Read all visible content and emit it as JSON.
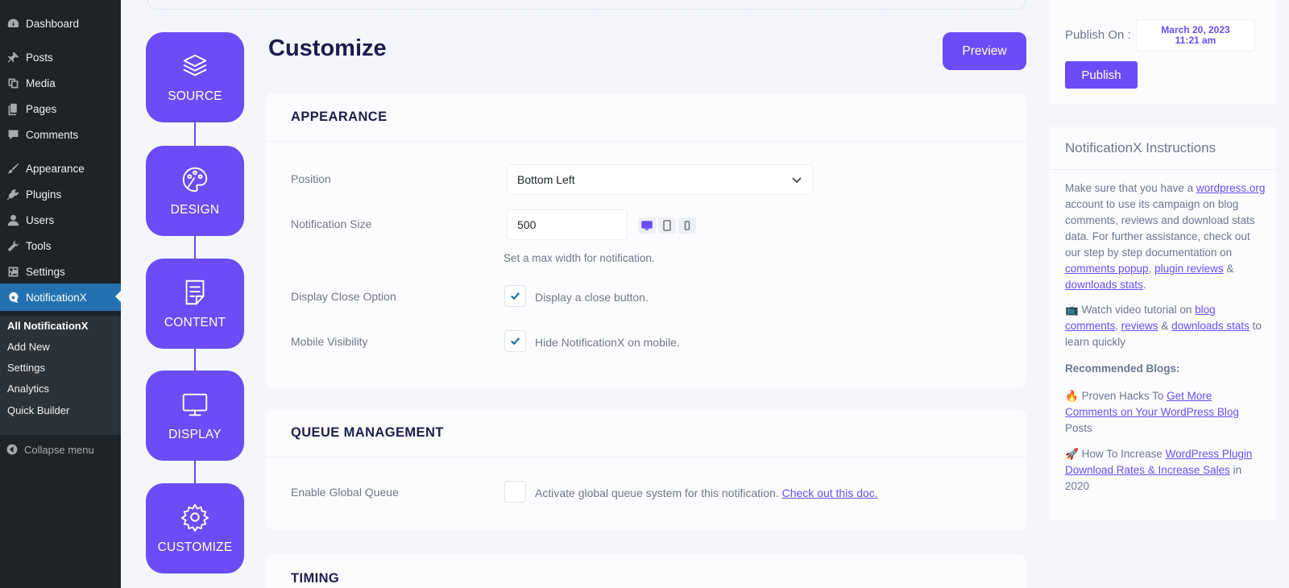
{
  "sidebar": {
    "items": [
      {
        "label": "Dashboard",
        "icon": "dashboard-icon"
      },
      {
        "label": "Posts",
        "icon": "pushpin-icon"
      },
      {
        "label": "Media",
        "icon": "media-icon"
      },
      {
        "label": "Pages",
        "icon": "pages-icon"
      },
      {
        "label": "Comments",
        "icon": "comment-icon"
      },
      {
        "label": "Appearance",
        "icon": "paintbrush-icon"
      },
      {
        "label": "Plugins",
        "icon": "plugin-icon"
      },
      {
        "label": "Users",
        "icon": "user-icon"
      },
      {
        "label": "Tools",
        "icon": "wrench-icon"
      },
      {
        "label": "Settings",
        "icon": "settings-icon"
      },
      {
        "label": "NotificationX",
        "icon": "notificationx-icon"
      }
    ],
    "submenu": [
      "All NotificationX",
      "Add New",
      "Settings",
      "Analytics",
      "Quick Builder"
    ],
    "collapse_label": "Collapse menu"
  },
  "steps": [
    {
      "label": "SOURCE",
      "icon": "layers-icon"
    },
    {
      "label": "DESIGN",
      "icon": "palette-icon"
    },
    {
      "label": "CONTENT",
      "icon": "document-icon"
    },
    {
      "label": "DISPLAY",
      "icon": "monitor-icon"
    },
    {
      "label": "CUSTOMIZE",
      "icon": "gear-icon"
    }
  ],
  "main": {
    "title": "Customize",
    "preview_label": "Preview",
    "appearance": {
      "heading": "APPEARANCE",
      "position_label": "Position",
      "position_value": "Bottom Left",
      "size_label": "Notification Size",
      "size_value": "500",
      "size_help": "Set a max width for notification.",
      "close_label": "Display Close Option",
      "close_text": "Display a close button.",
      "close_checked": true,
      "mobile_label": "Mobile Visibility",
      "mobile_text": "Hide NotificationX on mobile.",
      "mobile_checked": true
    },
    "queue": {
      "heading": "QUEUE MANAGEMENT",
      "global_label": "Enable Global Queue",
      "global_text": "Activate global queue system for this notification.",
      "global_link": "Check out this doc.",
      "global_checked": false
    },
    "timing": {
      "heading": "TIMING"
    }
  },
  "publish": {
    "label": "Publish On :",
    "date": "March 20, 2023",
    "time": "11:21 am",
    "button": "Publish"
  },
  "instructions": {
    "title": "NotificationX Instructions",
    "p1": {
      "t1": "Make sure that you have a ",
      "l1": "wordpress.org",
      "t2": " account to use its campaign on blog comments, reviews and download stats data. For further assistance, check out our step by step documentation on ",
      "l2": "comments popup",
      "t3": ", ",
      "l3": "plugin reviews",
      "t4": " & ",
      "l4": "downloads stats",
      "t5": "."
    },
    "p2": {
      "emoji": "📺",
      "t1": " Watch video tutorial on ",
      "l1": "blog comments",
      "t2": ", ",
      "l2": "reviews",
      "t3": " & ",
      "l3": "downloads stats",
      "t4": " to learn quickly"
    },
    "recommended": "Recommended Blogs:",
    "p3": {
      "emoji": "🔥",
      "t1": " Proven Hacks To ",
      "l1": "Get More Comments on Your WordPress Blog",
      "t2": " Posts"
    },
    "p4": {
      "emoji": "🚀",
      "t1": " How To Increase ",
      "l1": "WordPress Plugin Download Rates & Increase Sales",
      "t2": " in 2020"
    }
  },
  "colors": {
    "accent": "#6b4cf6",
    "wp_sidebar": "#1d2327",
    "wp_active": "#2271b1",
    "heading": "#1c1d4d"
  }
}
